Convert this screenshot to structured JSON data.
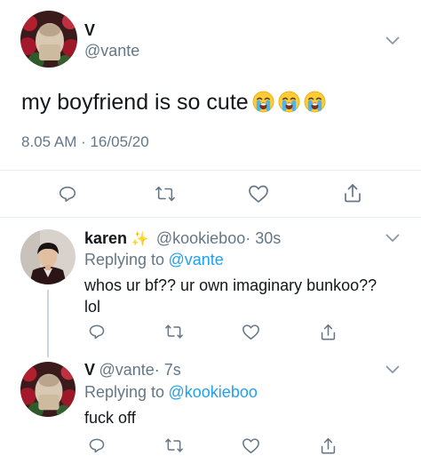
{
  "main_tweet": {
    "display_name": "V",
    "handle": "@vante",
    "text": "my boyfriend is so cute",
    "emoji_count_label": "3",
    "timestamp": "8.05 AM · 16/05/20"
  },
  "reply_1": {
    "display_name": "karen",
    "sparkle": "✨",
    "handle": "@kookieboo",
    "time": "· 30s",
    "replying_label": "Replying to",
    "replying_to": "@vante",
    "text": "whos ur bf?? ur own imaginary bunkoo?? lol"
  },
  "reply_2": {
    "display_name": "V",
    "handle": "@vante",
    "time": "· 7s",
    "replying_label": "Replying to",
    "replying_to": "@kookieboo",
    "text": "fuck off"
  },
  "colors": {
    "text": "#14171a",
    "secondary": "#657786",
    "link": "#1da1f2",
    "divider": "#e6ecf0",
    "icon": "#657786"
  },
  "icons": [
    "reply-icon",
    "retweet-icon",
    "like-icon",
    "share-icon",
    "chevron-down-icon",
    "loudly-crying-face-emoji"
  ]
}
